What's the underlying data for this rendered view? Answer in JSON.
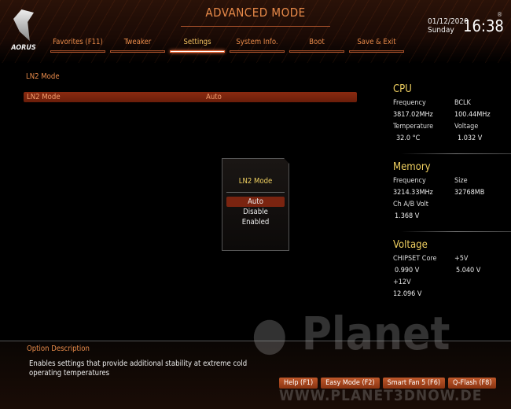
{
  "header": {
    "title": "ADVANCED MODE",
    "logo": "AORUS",
    "date": "01/12/2020",
    "day": "Sunday",
    "time": "16:38",
    "registered": "®"
  },
  "tabs": [
    {
      "label": "Favorites (F11)"
    },
    {
      "label": "Tweaker"
    },
    {
      "label": "Settings",
      "active": true
    },
    {
      "label": "System Info."
    },
    {
      "label": "Boot"
    },
    {
      "label": "Save & Exit"
    }
  ],
  "main": {
    "section": "LN2 Mode",
    "setting": {
      "label": "LN2 Mode",
      "value": "Auto"
    }
  },
  "popup": {
    "title": "LN2 Mode",
    "options": [
      "Auto",
      "Disable",
      "Enabled"
    ],
    "selected": "Auto"
  },
  "cpu": {
    "title": "CPU",
    "freq_label": "Frequency",
    "freq": "3817.02MHz",
    "bclk_label": "BCLK",
    "bclk": "100.44MHz",
    "temp_label": "Temperature",
    "temp": "32.0 °C",
    "volt_label": "Voltage",
    "volt": "1.032 V"
  },
  "memory": {
    "title": "Memory",
    "freq_label": "Frequency",
    "freq": "3214.33MHz",
    "size_label": "Size",
    "size": "32768MB",
    "volt_label": "Ch A/B Volt",
    "volt": "1.368 V"
  },
  "voltage": {
    "title": "Voltage",
    "chipset_label": "CHIPSET Core",
    "chipset": "0.990 V",
    "v5_label": "+5V",
    "v5": "5.040 V",
    "v12_label": "+12V",
    "v12": "12.096 V"
  },
  "description": {
    "heading": "Option Description",
    "text": "Enables settings that provide additional stability at extreme cold operating temperatures"
  },
  "footer": {
    "help": "Help (F1)",
    "easy": "Easy Mode (F2)",
    "fan": "Smart Fan 5 (F6)",
    "qflash": "Q-Flash (F8)"
  },
  "watermark": {
    "name": "Planet 3DNow!",
    "url": "WWW.PLANET3DNOW.DE"
  },
  "colors": {
    "accent": "#e98b4a",
    "highlight": "#f0d060",
    "selection": "#7a2410"
  }
}
